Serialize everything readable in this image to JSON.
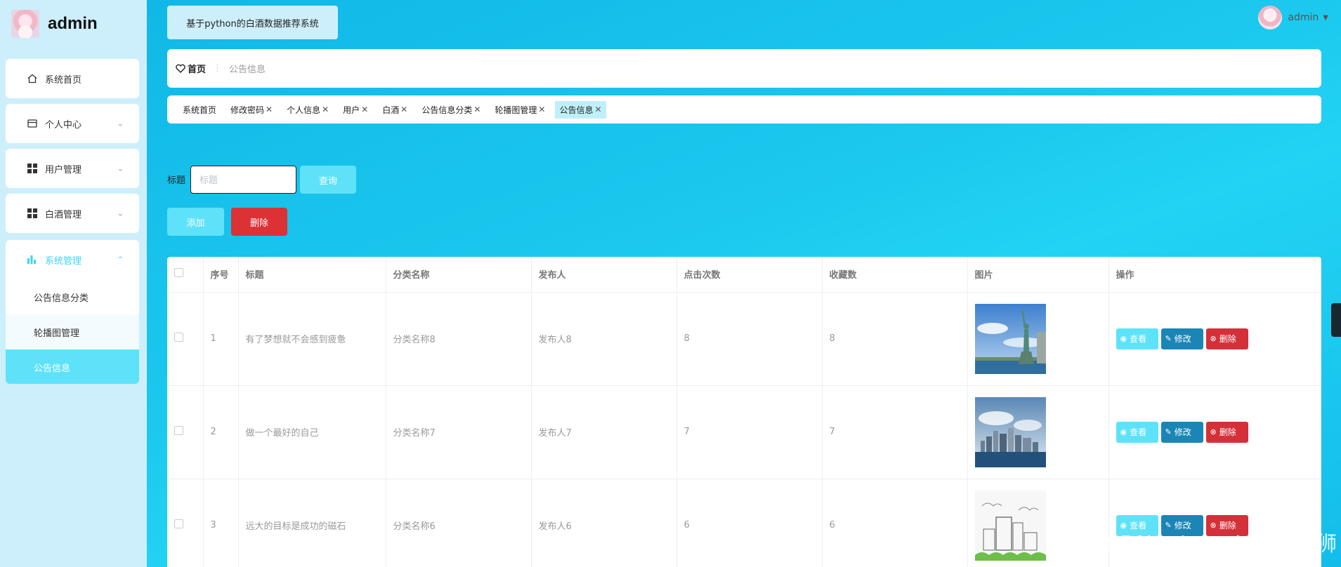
{
  "sidebar": {
    "brand_name": "admin",
    "items": [
      {
        "label": "系统首页",
        "icon": "home-icon"
      },
      {
        "label": "个人中心",
        "icon": "calendar-icon"
      },
      {
        "label": "用户管理",
        "icon": "grid-icon"
      },
      {
        "label": "白酒管理",
        "icon": "grid-icon"
      }
    ],
    "group": {
      "label": "系统管理",
      "icon": "bar-chart-icon",
      "children": [
        {
          "label": "公告信息分类"
        },
        {
          "label": "轮播图管理"
        },
        {
          "label": "公告信息"
        }
      ]
    }
  },
  "header": {
    "system_title": "基于python的白酒数据推荐系统",
    "username": "admin"
  },
  "breadcrumb": {
    "home": "首页",
    "current": "公告信息"
  },
  "tags": [
    {
      "label": "系统首页",
      "closable": false
    },
    {
      "label": "修改密码",
      "closable": true
    },
    {
      "label": "个人信息",
      "closable": true
    },
    {
      "label": "用户",
      "closable": true
    },
    {
      "label": "白酒",
      "closable": true
    },
    {
      "label": "公告信息分类",
      "closable": true
    },
    {
      "label": "轮播图管理",
      "closable": true
    },
    {
      "label": "公告信息",
      "closable": true,
      "active": true
    }
  ],
  "search": {
    "label": "标题",
    "placeholder": "标题",
    "query_button": "查询"
  },
  "actions": {
    "add_button": "添加",
    "delete_button": "删除"
  },
  "table": {
    "columns": [
      "序号",
      "标题",
      "分类名称",
      "发布人",
      "点击次数",
      "收藏数",
      "图片",
      "操作"
    ],
    "rows": [
      {
        "index": "1",
        "title": "有了梦想就不会感到疲惫",
        "category": "分类名称8",
        "publisher": "发布人8",
        "clicks": "8",
        "favorites": "8",
        "image": "statue-of-liberty-photo"
      },
      {
        "index": "2",
        "title": "做一个最好的自己",
        "category": "分类名称7",
        "publisher": "发布人7",
        "clicks": "7",
        "favorites": "7",
        "image": "city-skyline-photo"
      },
      {
        "index": "3",
        "title": "远大的目标是成功的磁石",
        "category": "分类名称6",
        "publisher": "发布人6",
        "clicks": "6",
        "favorites": "6",
        "image": "city-sketch-photo"
      }
    ],
    "op_labels": {
      "view": "查看",
      "edit": "修改",
      "delete": "删除"
    }
  },
  "watermark": "CSDN @Java_IoT 攻城狮",
  "colors": {
    "accent": "#5ee2fa",
    "edit": "#1b86b5",
    "danger": "#dc3135",
    "sidebar_bg": "#cdeffb"
  }
}
